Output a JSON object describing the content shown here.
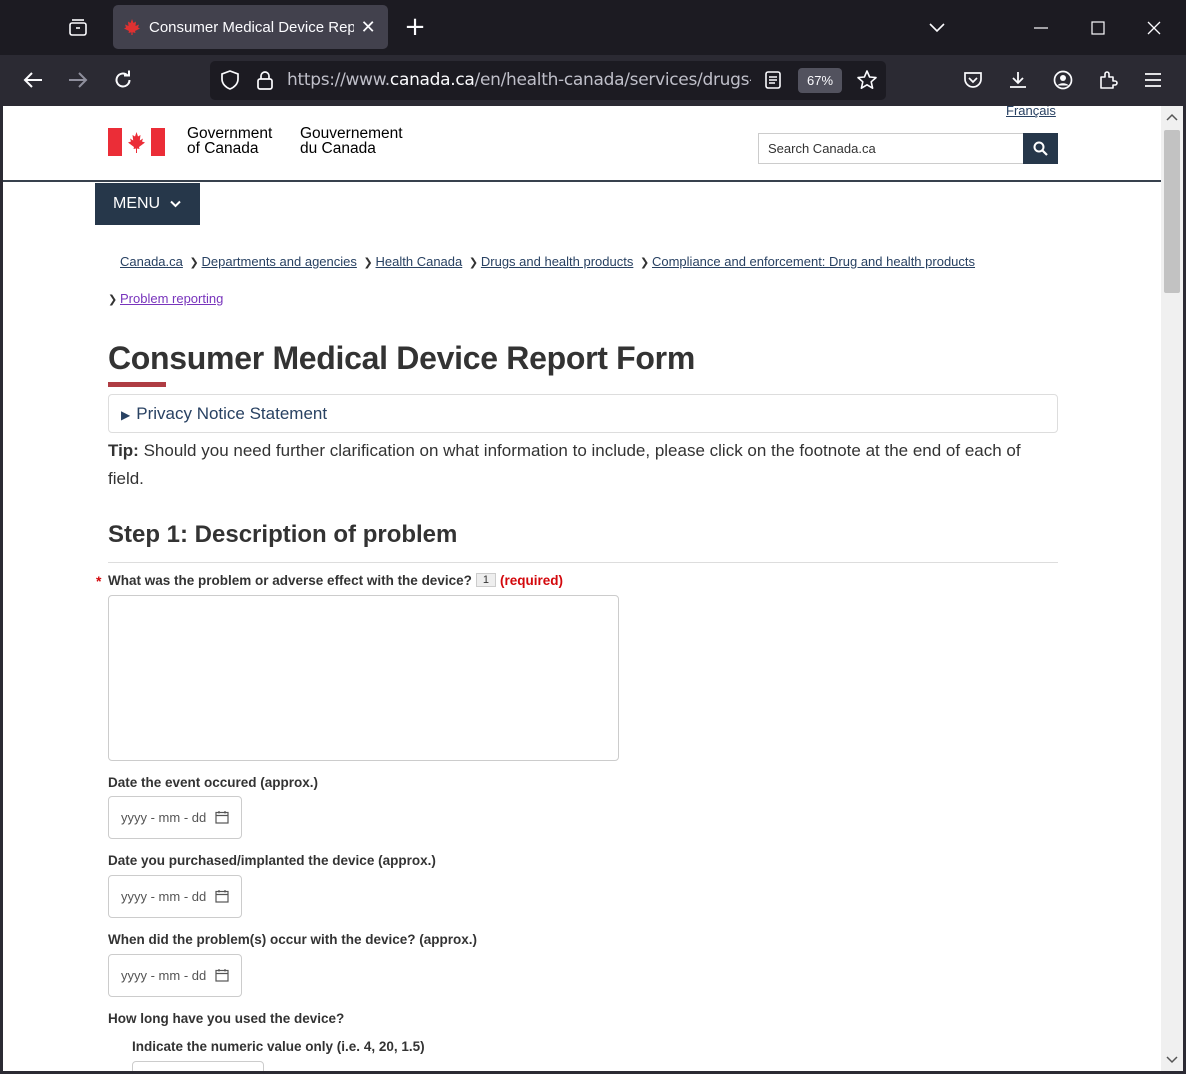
{
  "browser": {
    "tab_title": "Consumer Medical Device Repo",
    "url_scheme": "https://www.",
    "url_host": "canada.ca",
    "url_path": "/en/health-canada/services/drugs-heal",
    "zoom": "67%",
    "icons": [
      "tab-list-icon",
      "maple-leaf-favicon",
      "close-icon",
      "plus-icon",
      "chevron-down-icon",
      "minimize-icon",
      "maximize-icon",
      "window-close-icon",
      "back-icon",
      "forward-icon",
      "reload-icon",
      "shield-icon",
      "lock-icon",
      "reader-view-icon",
      "star-icon",
      "pocket-icon",
      "download-icon",
      "account-icon",
      "extensions-icon",
      "menu-icon"
    ]
  },
  "header": {
    "lang_link": "Français",
    "signature_en_line1": "Government",
    "signature_en_line2": "of Canada",
    "signature_fr_line1": "Gouvernement",
    "signature_fr_line2": "du Canada",
    "search_placeholder": "Search Canada.ca",
    "brand_colors": {
      "flag_red": "#eb2d37",
      "nav_dark": "#26374a",
      "title_underline": "#af3c43",
      "required_red": "#d3080c"
    }
  },
  "menu": {
    "label": "MENU"
  },
  "breadcrumb": [
    {
      "label": "Canada.ca",
      "visited": false
    },
    {
      "label": "Departments and agencies",
      "visited": false
    },
    {
      "label": "Health Canada",
      "visited": false
    },
    {
      "label": "Drugs and health products",
      "visited": false
    },
    {
      "label": "Compliance and enforcement: Drug and health products",
      "visited": false
    },
    {
      "label": "Problem reporting",
      "visited": true
    }
  ],
  "page": {
    "title": "Consumer Medical Device Report Form",
    "privacy_summary": "Privacy Notice Statement",
    "tip_label": "Tip:",
    "tip_text": " Should you need further clarification on what information to include, please click on the footnote at the end of each of field."
  },
  "step1": {
    "title": "Step 1: Description of problem",
    "q_problem": {
      "label": "What was the problem or adverse effect with the device?",
      "footnote": "1",
      "required": "(required)",
      "value": ""
    },
    "q_event_date": {
      "label": "Date the event occured (approx.)",
      "placeholder": "yyyy - mm - dd"
    },
    "q_purchase_date": {
      "label": "Date you purchased/implanted the device (approx.)",
      "placeholder": "yyyy - mm - dd"
    },
    "q_problem_date": {
      "label": "When did the problem(s) occur with the device? (approx.)",
      "placeholder": "yyyy - mm - dd"
    },
    "q_duration": {
      "label": "How long have you used the device?",
      "sub_label": "Indicate the numeric value only (i.e. 4, 20, 1.5)",
      "value": ""
    }
  }
}
